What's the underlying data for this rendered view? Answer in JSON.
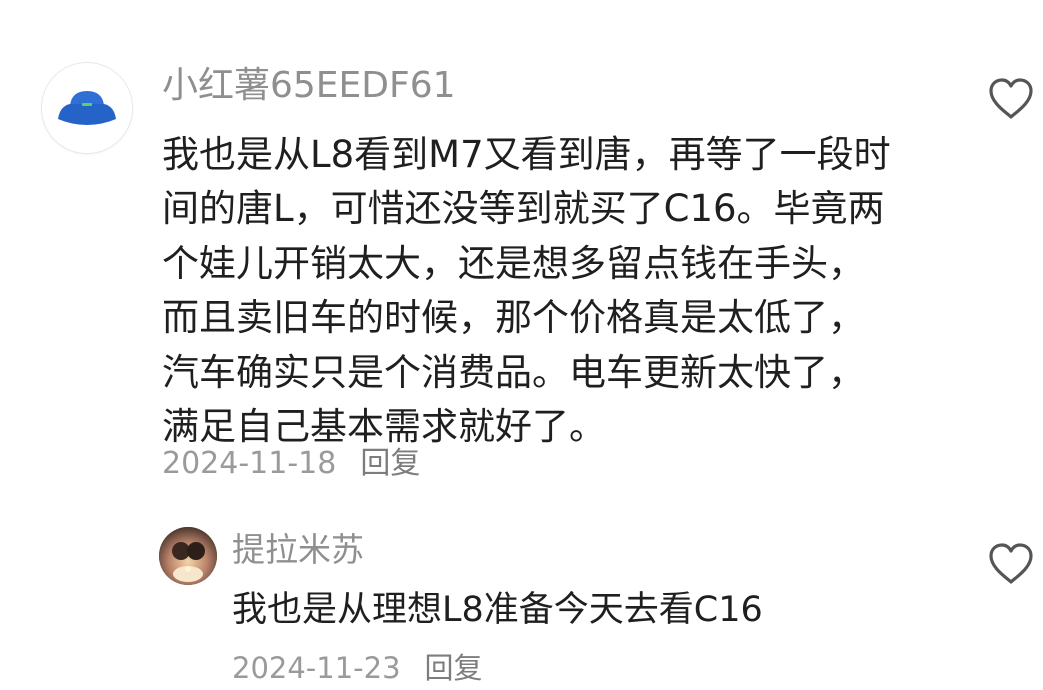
{
  "comments": [
    {
      "username": "小红薯65EEDF61",
      "avatar": "blue-bucket-hat-avatar",
      "lines": [
        "我也是从L8看到M7又看到唐，再等了一段时",
        "间的唐L，可惜还没等到就买了C16。毕竟两",
        "个娃儿开销太大，还是想多留点钱在手头，",
        "而且卖旧车的时候，那个价格真是太低了，",
        "汽车确实只是个消费品。电车更新太快了，",
        "满足自己基本需求就好了。"
      ],
      "date": "2024-11-18",
      "reply_label": "回复",
      "like_icon": "heart-outline-icon"
    },
    {
      "username": "提拉米苏",
      "avatar": "photo-avatar",
      "text": "我也是从理想L8准备今天去看C16",
      "date": "2024-11-23",
      "reply_label": "回复",
      "like_icon": "heart-outline-icon"
    }
  ],
  "colors": {
    "username": "#8f8f8f",
    "text": "#1f1f1f",
    "meta": "#9a9a9a",
    "avatar_hat": "#2f6fd6",
    "icon_stroke": "#555555"
  }
}
